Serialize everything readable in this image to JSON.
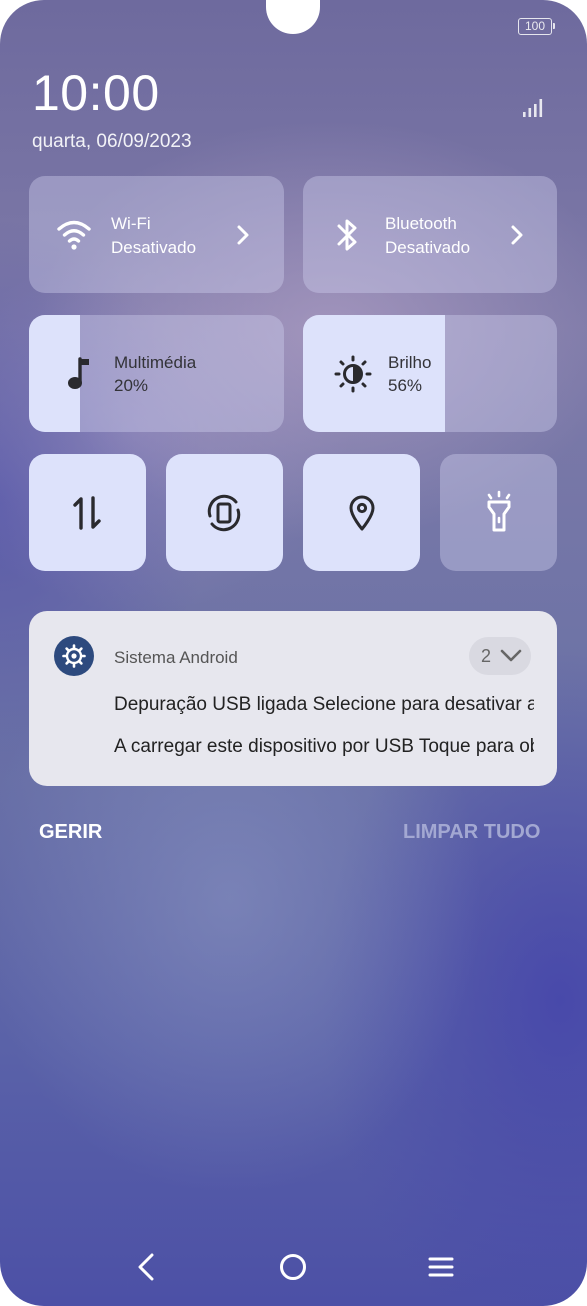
{
  "status_bar": {
    "battery": "100"
  },
  "lockscreen": {
    "time": "10:00",
    "date": "quarta, 06/09/2023"
  },
  "quick_settings": {
    "wifi": {
      "title": "Wi-Fi",
      "status": "Desativado"
    },
    "bluetooth": {
      "title": "Bluetooth",
      "status": "Desativado"
    },
    "media": {
      "title": "Multimédia",
      "value": "20%",
      "level": 0.2
    },
    "brightness": {
      "title": "Brilho",
      "value": "56%",
      "level": 0.56
    },
    "toggles": [
      {
        "icon": "mobile-data-icon",
        "active": true
      },
      {
        "icon": "auto-rotate-icon",
        "active": true
      },
      {
        "icon": "location-icon",
        "active": true
      },
      {
        "icon": "flashlight-icon",
        "active": false
      }
    ]
  },
  "notification": {
    "app": "Sistema Android",
    "count": "2",
    "lines": [
      "Depuração USB ligada  Selecione para desativar a depuração USB.",
      "A carregar este dispositivo por USB  Toque para obter mais opções."
    ]
  },
  "actions": {
    "manage": "GERIR",
    "clear_all": "LIMPAR TUDO"
  },
  "colors": {
    "tile_active": "#dde2fb",
    "clear_all": "#a3a8d2",
    "notif_bg": "#e7e7ee"
  }
}
